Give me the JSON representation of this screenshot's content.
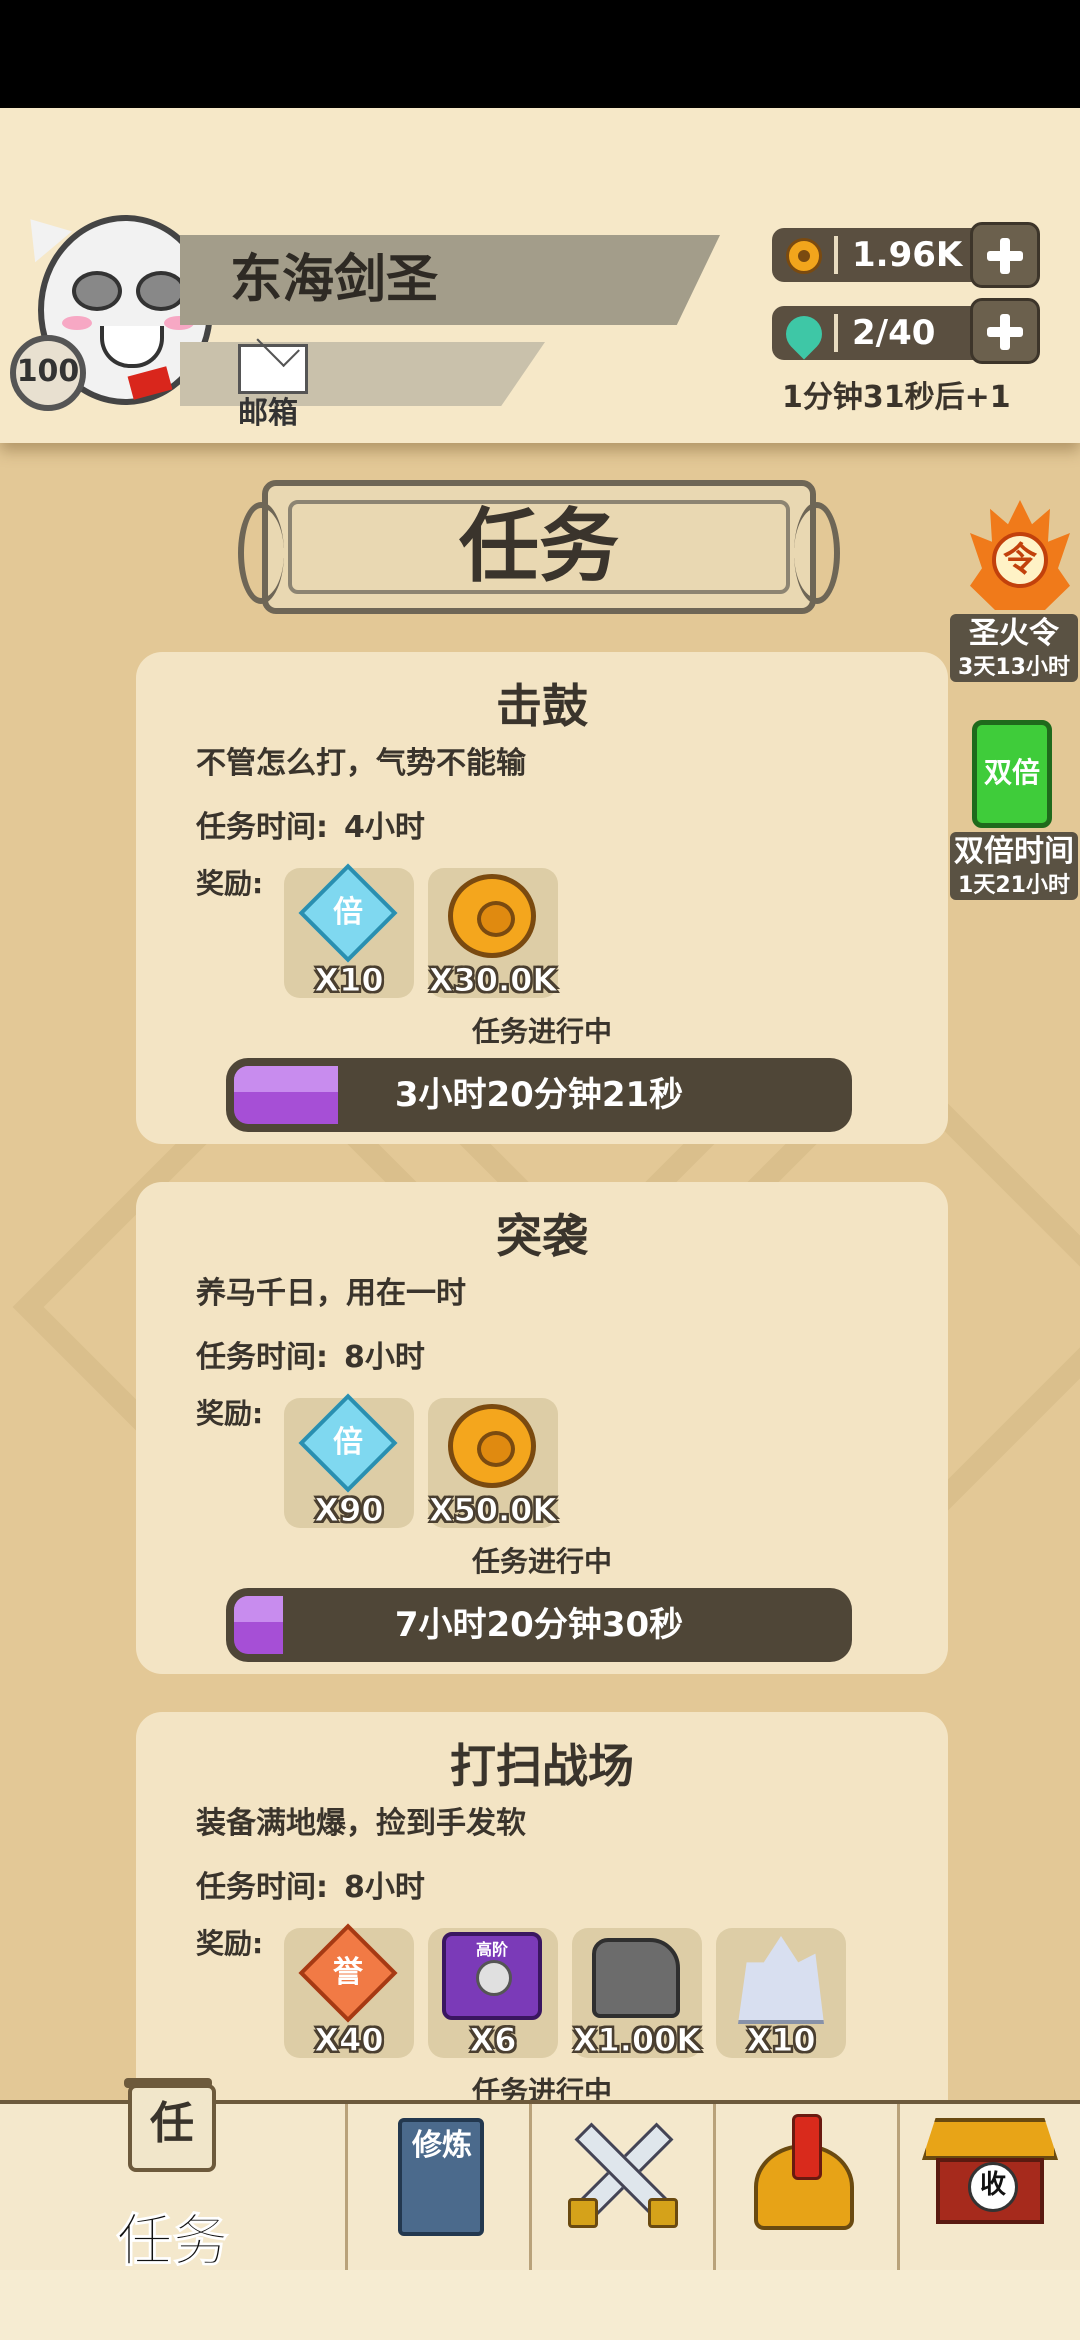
{
  "player": {
    "name": "东海剑圣",
    "level": "100"
  },
  "mailbox": {
    "label": "邮箱"
  },
  "resources": {
    "gold": {
      "icon": "coin-icon",
      "value": "1.96K"
    },
    "stamina": {
      "icon": "teal-drop-icon",
      "value": "2/40"
    },
    "regen_text": "1分钟31秒后+1"
  },
  "page_title": "任务",
  "side_events": [
    {
      "icon": "flame-token-icon",
      "icon_text": "令",
      "label": "圣火令",
      "sub": "3天13小时"
    },
    {
      "icon": "double-card-icon",
      "icon_text": "双倍",
      "label": "双倍时间",
      "sub": "1天21小时"
    }
  ],
  "task_labels": {
    "time_label": "任务时间:",
    "reward_label": "奖励:"
  },
  "tasks": [
    {
      "title": "击鼓",
      "desc": "不管怎么打，气势不能输",
      "duration": "4小时",
      "rewards": [
        {
          "icon": "multiplier-diamond-icon",
          "icon_text": "倍",
          "count": "X10"
        },
        {
          "icon": "gold-coin-icon",
          "count": "X30.0K"
        }
      ],
      "status": "任务进行中",
      "remaining": "3小时20分钟21秒",
      "progress": 0.17
    },
    {
      "title": "突袭",
      "desc": "养马千日，用在一时",
      "duration": "8小时",
      "rewards": [
        {
          "icon": "multiplier-diamond-icon",
          "icon_text": "倍",
          "count": "X90"
        },
        {
          "icon": "gold-coin-icon",
          "count": "X50.0K"
        }
      ],
      "status": "任务进行中",
      "remaining": "7小时20分钟30秒",
      "progress": 0.08
    },
    {
      "title": "打扫战场",
      "desc": "装备满地爆，捡到手发软",
      "duration": "8小时",
      "rewards": [
        {
          "icon": "honor-diamond-icon",
          "icon_text": "誉",
          "count": "X40"
        },
        {
          "icon": "advanced-gear-icon",
          "icon_text": "高阶",
          "count": "X6"
        },
        {
          "icon": "stone-icon",
          "count": "X1.00K"
        },
        {
          "icon": "crystal-icon",
          "count": "X10"
        }
      ],
      "status": "任务进行中"
    }
  ],
  "bottom_nav": {
    "task": {
      "badge": "任",
      "label": "任务"
    },
    "cultivate": {
      "icon_text": "修炼"
    },
    "battle": {
      "icon": "crossed-swords-icon"
    },
    "hero": {
      "icon": "helmet-icon"
    },
    "collect": {
      "icon_text": "收"
    }
  },
  "colors": {
    "background": "#e3c896",
    "header": "#f6e8c8",
    "card": "#f3e4c4",
    "progress_fill": "#a64fd6",
    "progress_track": "#4f4637"
  }
}
